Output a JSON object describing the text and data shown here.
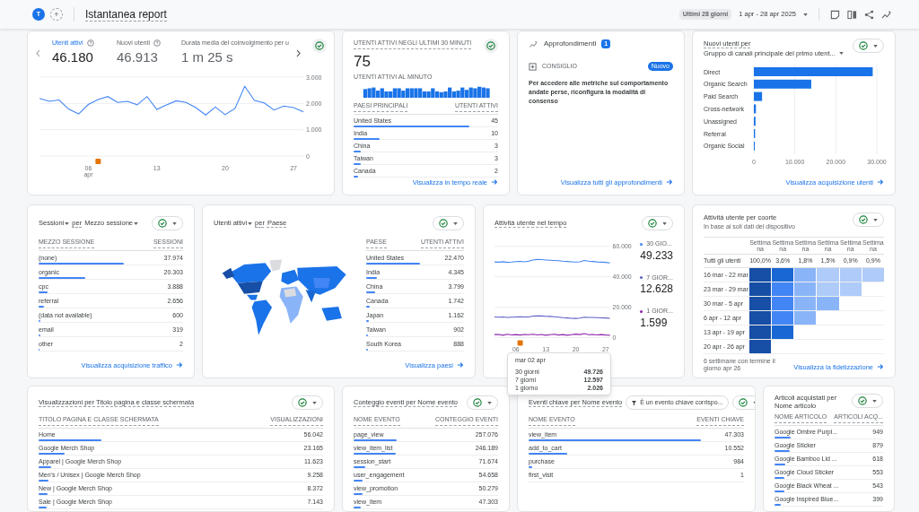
{
  "header": {
    "avatar": "T",
    "add": "+",
    "title": "Istantanea report",
    "range_label": "Ultimi 28 giorni",
    "range": "1 apr - 28 apr 2025"
  },
  "overview": {
    "metrics": [
      {
        "label": "Utenti attivi",
        "value": "46.180",
        "selected": true
      },
      {
        "label": "Nuovi utenti",
        "value": "46.913",
        "selected": false
      },
      {
        "label": "Durata media del coinvolgimento per u",
        "value": "1 m 25 s",
        "selected": false
      }
    ],
    "chart_data": {
      "type": "line",
      "x": [
        1,
        2,
        3,
        4,
        5,
        6,
        7,
        8,
        9,
        10,
        11,
        12,
        13,
        14,
        15,
        16,
        17,
        18,
        19,
        20,
        21,
        22,
        23,
        24,
        25,
        26,
        27,
        28
      ],
      "xlim": [
        1,
        28
      ],
      "ylim": [
        0,
        3000
      ],
      "xticks": [
        {
          "value": 6,
          "label": "06 apr"
        },
        {
          "value": 13,
          "label": "13"
        },
        {
          "value": 20,
          "label": "20"
        },
        {
          "value": 27,
          "label": "27"
        }
      ],
      "yticks": [
        {
          "value": 0,
          "label": "0"
        },
        {
          "value": 1000,
          "label": "1.000"
        },
        {
          "value": 2000,
          "label": "2.000"
        },
        {
          "value": 3000,
          "label": "3.000"
        }
      ],
      "series": [
        {
          "color": "#4285f4",
          "values": [
            2190,
            2080,
            2130,
            1780,
            1600,
            1960,
            2150,
            2260,
            2040,
            2080,
            1950,
            2260,
            1770,
            1940,
            2100,
            2040,
            1840,
            1560,
            1860,
            1570,
            1810,
            2650,
            2110,
            2020,
            1750,
            1900,
            1840,
            1680
          ]
        }
      ]
    }
  },
  "realtime": {
    "title": "UTENTI ATTIVI NEGLI ULTIMI 30 MINUTI",
    "value": "75",
    "subtitle": "UTENTI ATTIVI AL MINUTO",
    "columns": [
      "PAESI PRINCIPALI",
      "UTENTI ATTIVI"
    ],
    "rows": [
      {
        "label": "United States",
        "value": "45",
        "level": 0.8
      },
      {
        "label": "India",
        "value": "10",
        "level": 0.18
      },
      {
        "label": "China",
        "value": "3",
        "level": 0.05
      },
      {
        "label": "Taiwan",
        "value": "3",
        "level": 0.05
      },
      {
        "label": "Canada",
        "value": "2",
        "level": 0.03
      }
    ],
    "link": "Visualizza in tempo reale"
  },
  "insights": {
    "title": "Approfondimenti",
    "count": "1",
    "tag": "CONSIGLIO",
    "badge": "Nuovo",
    "text": "Per accedere alle metriche sul comportamento andate perse, riconfigura la modalità di consenso",
    "link": "Visualizza tutti gli approfondimenti"
  },
  "new_users": {
    "title": "Nuovi utenti per",
    "dimension": "Gruppo di canali principale del primo utent...",
    "chart_data": {
      "type": "bar",
      "orientation": "horizontal",
      "categories": [
        "Direct",
        "Organic Search",
        "Paid Search",
        "Cross-network",
        "Unassigned",
        "Referral",
        "Organic Social"
      ],
      "values": [
        29000,
        14000,
        2000,
        500,
        400,
        300,
        200
      ],
      "xlim": [
        0,
        30000
      ],
      "xticks": [
        {
          "value": 0,
          "label": "0"
        },
        {
          "value": 10000,
          "label": "10.000"
        },
        {
          "value": 20000,
          "label": "20.000"
        },
        {
          "value": 30000,
          "label": "30.000"
        }
      ]
    },
    "link": "Visualizza acquisizione utenti"
  },
  "sessions": {
    "title_parts": [
      {
        "text": "Sessioni",
        "dropdown": true
      },
      {
        "text": "per",
        "dropdown": false
      },
      {
        "text": "Mezzo sessione",
        "dropdown": true
      }
    ],
    "columns": [
      "MEZZO SESSIONE",
      "SESSIONI"
    ],
    "rows": [
      {
        "label": "(none)",
        "value": "37.974",
        "level": 0.59
      },
      {
        "label": "organic",
        "value": "20.303",
        "level": 0.32
      },
      {
        "label": "cpc",
        "value": "3.888",
        "level": 0.06
      },
      {
        "label": "referral",
        "value": "2.656",
        "level": 0.04
      },
      {
        "label": "(data not available)",
        "value": "600",
        "level": 0.012
      },
      {
        "label": "email",
        "value": "319",
        "level": 0.01
      },
      {
        "label": "other",
        "value": "2",
        "level": 0.005
      }
    ],
    "link": "Visualizza acquisizione traffico"
  },
  "countries": {
    "title_parts": [
      {
        "text": "Utenti attivi",
        "dropdown": true
      },
      {
        "text": "per",
        "dropdown": false
      },
      {
        "text": "Paese",
        "dropdown": false
      }
    ],
    "columns": [
      "PAESE",
      "UTENTI ATTIVI"
    ],
    "rows": [
      {
        "label": "United States",
        "value": "22.470",
        "level": 0.55
      },
      {
        "label": "India",
        "value": "4.345",
        "level": 0.11
      },
      {
        "label": "China",
        "value": "3.799",
        "level": 0.09
      },
      {
        "label": "Canada",
        "value": "1.742",
        "level": 0.04
      },
      {
        "label": "Japan",
        "value": "1.162",
        "level": 0.03
      },
      {
        "label": "Taiwan",
        "value": "902",
        "level": 0.02
      },
      {
        "label": "South Korea",
        "value": "888",
        "level": 0.02
      }
    ],
    "link": "Visualizza paesi"
  },
  "activity": {
    "title": "Attività utente nel tempo",
    "chart_data": {
      "type": "line",
      "x": [
        1,
        2,
        3,
        4,
        5,
        6,
        7,
        8,
        9,
        10,
        11,
        12,
        13,
        14,
        15,
        16,
        17,
        18,
        19,
        20,
        21,
        22,
        23,
        24,
        25,
        26,
        27,
        28
      ],
      "xlim": [
        1,
        28
      ],
      "ylim": [
        0,
        60000
      ],
      "xticks": [
        {
          "value": 6,
          "label": "06"
        },
        {
          "value": 13,
          "label": "13"
        },
        {
          "value": 20,
          "label": "20"
        },
        {
          "value": 27,
          "label": "27"
        }
      ],
      "yticks": [
        {
          "value": 0,
          "label": "0"
        },
        {
          "value": 20000,
          "label": "20.000"
        },
        {
          "value": 40000,
          "label": "40.000"
        },
        {
          "value": 60000,
          "label": "60.000"
        }
      ],
      "series": [
        {
          "color": "#4285f4",
          "values": [
            49700,
            49500,
            49800,
            49400,
            49600,
            49900,
            50100,
            49800,
            50200,
            51000,
            51300,
            51200,
            51000,
            50800,
            50700,
            50500,
            50200,
            50000,
            49800,
            49600,
            49800,
            50600,
            50200,
            50000,
            49700,
            49500,
            49400,
            49000
          ]
        },
        {
          "color": "#5b5fc7",
          "values": [
            13500,
            13400,
            13600,
            13200,
            13400,
            13500,
            13700,
            13500,
            13600,
            14100,
            14300,
            14200,
            14000,
            13900,
            13700,
            13400,
            13100,
            12900,
            12700,
            12600,
            12800,
            13400,
            13300,
            13200,
            13100,
            13000,
            12900,
            12700
          ]
        },
        {
          "color": "#8e24aa",
          "values": [
            2000,
            2100,
            1600,
            2200,
            1800,
            2000,
            1700,
            2100,
            1900,
            2200,
            1800,
            2100,
            1600,
            1900,
            2200,
            1700,
            2000,
            1600,
            1900,
            2300,
            2000,
            2700,
            1900,
            2100,
            1800,
            2000,
            1700,
            1600
          ]
        }
      ]
    },
    "legend": [
      {
        "label": "30 GIO...",
        "value": "49.233",
        "color": "#4285f4"
      },
      {
        "label": "7 GIOR...",
        "value": "12.628",
        "color": "#5b5fc7"
      },
      {
        "label": "1 GIOR...",
        "value": "1.599",
        "color": "#8e24aa"
      }
    ]
  },
  "cohort": {
    "title": "Attività utente per coorte",
    "subtitle": "In base ai soli dati del dispositivo",
    "columns": [
      "Settimana",
      "Settimana",
      "Settimana",
      "Settimana",
      "Settimana",
      "Settimana"
    ],
    "total_label": "Tutti gli utenti",
    "totals": [
      "100,0%",
      "3,6%",
      "1,8%",
      "1,5%",
      "0,9%",
      "0,9%"
    ],
    "rows": [
      {
        "label": "16 mar - 22 mar",
        "cells": [
          {
            "color": "#174ea6"
          },
          {
            "color": "#1967d2"
          },
          {
            "color": "#8ab4f8"
          },
          {
            "color": "#aecbfa"
          },
          {
            "color": "#aecbfa"
          },
          {
            "color": "#aecbfa"
          }
        ]
      },
      {
        "label": "23 mar - 29 mar",
        "cells": [
          {
            "color": "#174ea6"
          },
          {
            "color": "#4285f4"
          },
          {
            "color": "#8ab4f8"
          },
          {
            "color": "#aecbfa"
          },
          {
            "color": "#aecbfa"
          }
        ]
      },
      {
        "label": "30 mar - 5 apr",
        "cells": [
          {
            "color": "#174ea6"
          },
          {
            "color": "#4285f4"
          },
          {
            "color": "#8ab4f8"
          },
          {
            "color": "#8ab4f8"
          }
        ]
      },
      {
        "label": "6 apr - 12 apr",
        "cells": [
          {
            "color": "#174ea6"
          },
          {
            "color": "#4285f4"
          },
          {
            "color": "#8ab4f8"
          }
        ]
      },
      {
        "label": "13 apr - 19 apr",
        "cells": [
          {
            "color": "#174ea6"
          },
          {
            "color": "#1967d2"
          }
        ]
      },
      {
        "label": "20 apr - 26 apr",
        "cells": [
          {
            "color": "#174ea6"
          }
        ]
      }
    ],
    "footnote": "6 settimane con termine il giorno apr 26",
    "link": "Visualizza la fidelizzazione"
  },
  "views": {
    "title": "Visualizzazioni per Titolo pagina e classe schermata",
    "columns": [
      "TITOLO PAGINA E CLASSE SCHERMATA",
      "VISUALIZZAZIONI"
    ],
    "rows": [
      {
        "label": "Home",
        "value": "56.042",
        "level": 0.22
      },
      {
        "label": "Google Merch Shop",
        "value": "23.165",
        "level": 0.09
      },
      {
        "label": "Apparel | Google Merch Shop",
        "value": "11.623",
        "level": 0.045
      },
      {
        "label": "Men's / Unisex | Google Merch Shop",
        "value": "9.258",
        "level": 0.036
      },
      {
        "label": "New | Google Merch Shop",
        "value": "8.372",
        "level": 0.032
      },
      {
        "label": "Sale | Google Merch Shop",
        "value": "7.143",
        "level": 0.028
      }
    ]
  },
  "events": {
    "title": "Conteggio eventi per Nome evento",
    "columns": [
      "NOME EVENTO",
      "CONTEGGIO EVENTI"
    ],
    "rows": [
      {
        "label": "page_view",
        "value": "257.076",
        "level": 0.3
      },
      {
        "label": "view_item_list",
        "value": "246.189",
        "level": 0.29
      },
      {
        "label": "session_start",
        "value": "71.674",
        "level": 0.08
      },
      {
        "label": "user_engagement",
        "value": "54.658",
        "level": 0.06
      },
      {
        "label": "view_promotion",
        "value": "50.279",
        "level": 0.06
      },
      {
        "label": "view_item",
        "value": "47.303",
        "level": 0.05
      }
    ]
  },
  "key_events": {
    "title": "Eventi chiave per Nome evento",
    "filter": "È un evento chiave corrispo...",
    "columns": [
      "NOME EVENTO",
      "EVENTI CHIAVE"
    ],
    "rows": [
      {
        "label": "view_item",
        "value": "47.303",
        "level": 0.8
      },
      {
        "label": "add_to_cart",
        "value": "10.552",
        "level": 0.18
      },
      {
        "label": "purchase",
        "value": "984",
        "level": 0.015
      },
      {
        "label": "first_visit",
        "value": "1"
      }
    ]
  },
  "items": {
    "title": "Articoli acquistati per Nome articolo",
    "columns": [
      "NOME ARTICOLO",
      "ARTICOLI ACQ..."
    ],
    "rows": [
      {
        "label": "Google Ombre Purpl...",
        "value": "949",
        "level": 0.15
      },
      {
        "label": "Google Sticker",
        "value": "879",
        "level": 0.14
      },
      {
        "label": "Google Bamboo Lid ...",
        "value": "618",
        "level": 0.1
      },
      {
        "label": "Google Cloud Sticker",
        "value": "553",
        "level": 0.09
      },
      {
        "label": "Google Black Wheat ...",
        "value": "543",
        "level": 0.09
      },
      {
        "label": "Google Inspired Blue...",
        "value": "399",
        "level": 0.06
      }
    ]
  },
  "tooltip": {
    "date": "mar 02 apr",
    "rows": [
      {
        "label": "30 giorni",
        "value": "49.726"
      },
      {
        "label": "7 giorni",
        "value": "12.597"
      },
      {
        "label": "1 giorno",
        "value": "2.026"
      }
    ]
  }
}
